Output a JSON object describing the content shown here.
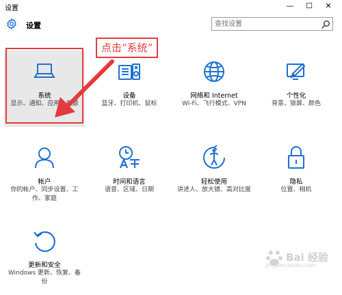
{
  "window": {
    "title": "设置",
    "minimize": "—",
    "maximize": "☐",
    "close": "✕"
  },
  "header": {
    "title": "设置",
    "search_placeholder": "查找设置"
  },
  "annotation": {
    "text": "点击“系统”"
  },
  "tiles": [
    {
      "name": "系统",
      "desc": "显示、通知、应用、电源",
      "icon": "laptop-icon"
    },
    {
      "name": "设备",
      "desc": "蓝牙、打印机、鼠标",
      "icon": "keyboard-speaker-icon"
    },
    {
      "name": "网络和 Internet",
      "desc": "Wi-Fi、飞行模式、VPN",
      "icon": "globe-icon"
    },
    {
      "name": "个性化",
      "desc": "背景、锁屏、颜色",
      "icon": "paint-icon"
    },
    {
      "name": "帐户",
      "desc": "你的帐户、同步设置、工作、家庭",
      "icon": "person-icon"
    },
    {
      "name": "时间和语言",
      "desc": "语音、区域、日期",
      "icon": "time-language-icon"
    },
    {
      "name": "轻松使用",
      "desc": "讲述人、放大镜、高对比度",
      "icon": "ease-of-access-icon"
    },
    {
      "name": "隐私",
      "desc": "位置、相机",
      "icon": "lock-icon"
    },
    {
      "name": "更新和安全",
      "desc": "Windows 更新、恢复、备份",
      "icon": "refresh-icon"
    }
  ],
  "watermark": {
    "text": "Bai 经验",
    "sub": "jingyan.baidu.com"
  },
  "colors": {
    "accent": "#1e6fd0",
    "annotation": "#e23b3b"
  }
}
